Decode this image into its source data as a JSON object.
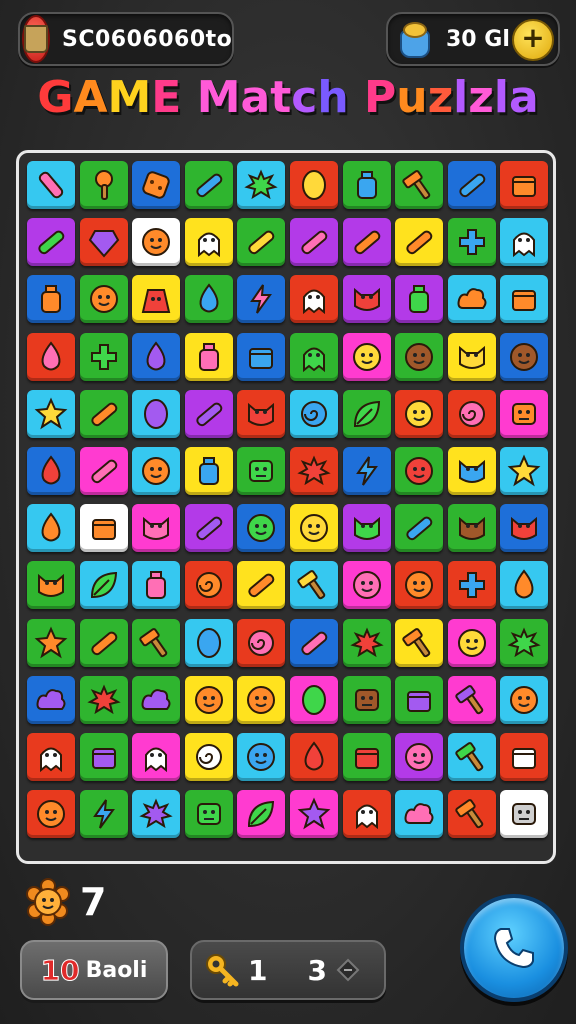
{
  "header": {
    "score_text": "SC0606060to",
    "coin_text": "30 Gl",
    "plus_symbol": "+"
  },
  "title": {
    "letters": [
      {
        "ch": "G",
        "color": "#ff3b3b"
      },
      {
        "ch": "A",
        "color": "#ff8a1e"
      },
      {
        "ch": "M",
        "color": "#ffd21e"
      },
      {
        "ch": "E",
        "color": "#ff3b8a"
      },
      {
        "ch": " ",
        "color": "#ffffff"
      },
      {
        "ch": "M",
        "color": "#ff5ad8"
      },
      {
        "ch": "a",
        "color": "#ff5ad8"
      },
      {
        "ch": "t",
        "color": "#ff5ad8"
      },
      {
        "ch": "c",
        "color": "#b35aff"
      },
      {
        "ch": "h",
        "color": "#7a5aff"
      },
      {
        "ch": " ",
        "color": "#ffffff"
      },
      {
        "ch": "P",
        "color": "#ff3b8a"
      },
      {
        "ch": "u",
        "color": "#ff8a1e"
      },
      {
        "ch": "z",
        "color": "#ff5a3b"
      },
      {
        "ch": "l",
        "color": "#b35aff"
      },
      {
        "ch": "z",
        "color": "#ff5ad8"
      },
      {
        "ch": "l",
        "color": "#b35aff"
      },
      {
        "ch": "a",
        "color": "#b35aff"
      }
    ]
  },
  "board": {
    "tiles": [
      [
        "#36c8f0",
        "pink",
        "lipstick"
      ],
      [
        "#2fb52f",
        "orange",
        "club"
      ],
      [
        "#1e6fd9",
        "orange",
        "cookie"
      ],
      [
        "#2fb52f",
        "blue",
        "bar"
      ],
      [
        "#36c8f0",
        "green",
        "splat"
      ],
      [
        "#e83a1e",
        "yellow",
        "oval"
      ],
      [
        "#2fb52f",
        "blue",
        "bottle"
      ],
      [
        "#2fb52f",
        "orange",
        "hammer"
      ],
      [
        "#1e6fd9",
        "blue",
        "bar"
      ],
      [
        "#e83a1e",
        "orange",
        "box"
      ],
      [
        "#b33ae8",
        "green",
        "bar"
      ],
      [
        "#e83a1e",
        "purple",
        "gem"
      ],
      [
        "#ffffff",
        "orange",
        "face"
      ],
      [
        "#ffe21e",
        "white",
        "ghost"
      ],
      [
        "#2fb52f",
        "yellow",
        "bar"
      ],
      [
        "#b33ae8",
        "pink",
        "bar"
      ],
      [
        "#b33ae8",
        "orange",
        "bar"
      ],
      [
        "#ffe21e",
        "orange",
        "bar"
      ],
      [
        "#2fb52f",
        "blue",
        "cross"
      ],
      [
        "#36c8f0",
        "white",
        "ghost"
      ],
      [
        "#1e6fd9",
        "orange",
        "bottle"
      ],
      [
        "#2fb52f",
        "orange",
        "face"
      ],
      [
        "#ffe21e",
        "red",
        "bag"
      ],
      [
        "#2fb52f",
        "blue",
        "drop"
      ],
      [
        "#1e6fd9",
        "pink",
        "bolt"
      ],
      [
        "#e83a1e",
        "white",
        "ghost"
      ],
      [
        "#b33ae8",
        "red",
        "cat"
      ],
      [
        "#b33ae8",
        "green",
        "bottle"
      ],
      [
        "#36c8f0",
        "orange",
        "cloud"
      ],
      [
        "#36c8f0",
        "orange",
        "box"
      ],
      [
        "#e83a1e",
        "pink",
        "drop"
      ],
      [
        "#2fb52f",
        "green",
        "cross"
      ],
      [
        "#1e6fd9",
        "purple",
        "drop"
      ],
      [
        "#ffe21e",
        "pink",
        "bottle"
      ],
      [
        "#1e6fd9",
        "blue",
        "box"
      ],
      [
        "#2fb52f",
        "green",
        "ghost"
      ],
      [
        "#ff3bd0",
        "yellow",
        "face"
      ],
      [
        "#2fb52f",
        "brown",
        "face"
      ],
      [
        "#ffe21e",
        "yellow",
        "cat"
      ],
      [
        "#1e6fd9",
        "brown",
        "face"
      ],
      [
        "#36c8f0",
        "yellow",
        "star"
      ],
      [
        "#2fb52f",
        "orange",
        "bar"
      ],
      [
        "#36c8f0",
        "purple",
        "oval"
      ],
      [
        "#b33ae8",
        "purple",
        "bar"
      ],
      [
        "#e83a1e",
        "red",
        "cat"
      ],
      [
        "#36c8f0",
        "blue",
        "swirl"
      ],
      [
        "#2fb52f",
        "green",
        "leaf"
      ],
      [
        "#e83a1e",
        "yellow",
        "face"
      ],
      [
        "#e83a1e",
        "pink",
        "swirl"
      ],
      [
        "#ff3bd0",
        "orange",
        "robot"
      ],
      [
        "#1e6fd9",
        "red",
        "drop"
      ],
      [
        "#ff3bd0",
        "pink",
        "bar"
      ],
      [
        "#36c8f0",
        "orange",
        "face"
      ],
      [
        "#ffe21e",
        "blue",
        "bottle"
      ],
      [
        "#2fb52f",
        "green",
        "robot"
      ],
      [
        "#e83a1e",
        "red",
        "splat"
      ],
      [
        "#1e6fd9",
        "blue",
        "bolt"
      ],
      [
        "#2fb52f",
        "red",
        "face"
      ],
      [
        "#ffe21e",
        "blue",
        "cat"
      ],
      [
        "#36c8f0",
        "yellow",
        "star"
      ],
      [
        "#36c8f0",
        "orange",
        "drop"
      ],
      [
        "#ffffff",
        "orange",
        "box"
      ],
      [
        "#ff3bd0",
        "pink",
        "cat"
      ],
      [
        "#b33ae8",
        "purple",
        "bar"
      ],
      [
        "#1e6fd9",
        "green",
        "face"
      ],
      [
        "#ffe21e",
        "yellow",
        "face"
      ],
      [
        "#b33ae8",
        "green",
        "cat"
      ],
      [
        "#2fb52f",
        "blue",
        "bar"
      ],
      [
        "#2fb52f",
        "brown",
        "cat"
      ],
      [
        "#1e6fd9",
        "red",
        "cat"
      ],
      [
        "#2fb52f",
        "orange",
        "cat"
      ],
      [
        "#36c8f0",
        "green",
        "leaf"
      ],
      [
        "#36c8f0",
        "pink",
        "bottle"
      ],
      [
        "#e83a1e",
        "orange",
        "swirl"
      ],
      [
        "#ffe21e",
        "orange",
        "bar"
      ],
      [
        "#36c8f0",
        "yellow",
        "hammer"
      ],
      [
        "#ff3bd0",
        "pink",
        "face"
      ],
      [
        "#e83a1e",
        "orange",
        "face"
      ],
      [
        "#e83a1e",
        "blue",
        "cross"
      ],
      [
        "#36c8f0",
        "orange",
        "drop"
      ],
      [
        "#2fb52f",
        "orange",
        "star"
      ],
      [
        "#2fb52f",
        "orange",
        "bar"
      ],
      [
        "#2fb52f",
        "orange",
        "hammer"
      ],
      [
        "#36c8f0",
        "blue",
        "oval"
      ],
      [
        "#e83a1e",
        "pink",
        "swirl"
      ],
      [
        "#1e6fd9",
        "pink",
        "bar"
      ],
      [
        "#2fb52f",
        "red",
        "splat"
      ],
      [
        "#ffe21e",
        "orange",
        "hammer"
      ],
      [
        "#ff3bd0",
        "yellow",
        "face"
      ],
      [
        "#2fb52f",
        "green",
        "splat"
      ],
      [
        "#1e6fd9",
        "purple",
        "cloud"
      ],
      [
        "#2fb52f",
        "red",
        "splat"
      ],
      [
        "#2fb52f",
        "purple",
        "cloud"
      ],
      [
        "#ffe21e",
        "orange",
        "face"
      ],
      [
        "#ffe21e",
        "orange",
        "face"
      ],
      [
        "#ff3bd0",
        "green",
        "oval"
      ],
      [
        "#2fb52f",
        "brown",
        "robot"
      ],
      [
        "#2fb52f",
        "purple",
        "box"
      ],
      [
        "#ff3bd0",
        "purple",
        "hammer"
      ],
      [
        "#36c8f0",
        "orange",
        "face"
      ],
      [
        "#e83a1e",
        "white",
        "ghost"
      ],
      [
        "#2fb52f",
        "purple",
        "box"
      ],
      [
        "#ff3bd0",
        "white",
        "ghost"
      ],
      [
        "#ffe21e",
        "white",
        "swirl"
      ],
      [
        "#36c8f0",
        "blue",
        "face"
      ],
      [
        "#e83a1e",
        "red",
        "drop"
      ],
      [
        "#2fb52f",
        "red",
        "box"
      ],
      [
        "#b33ae8",
        "pink",
        "face"
      ],
      [
        "#36c8f0",
        "green",
        "hammer"
      ],
      [
        "#e83a1e",
        "white",
        "box"
      ],
      [
        "#e83a1e",
        "orange",
        "face"
      ],
      [
        "#2fb52f",
        "blue",
        "bolt"
      ],
      [
        "#36c8f0",
        "purple",
        "splat"
      ],
      [
        "#2fb52f",
        "green",
        "robot"
      ],
      [
        "#ff3bd0",
        "green",
        "leaf"
      ],
      [
        "#ff3bd0",
        "purple",
        "star"
      ],
      [
        "#e83a1e",
        "white",
        "ghost"
      ],
      [
        "#36c8f0",
        "pink",
        "cloud"
      ],
      [
        "#e83a1e",
        "orange",
        "hammer"
      ],
      [
        "#ffffff",
        "gray",
        "robot"
      ]
    ]
  },
  "moves": {
    "count": "7"
  },
  "ball_button": {
    "number": "10",
    "label": "Baoli"
  },
  "key_counter": {
    "key_count": "1",
    "lock_count": "3"
  },
  "icons": {
    "score": "trophy-cup-icon",
    "coin": "coin-bag-icon",
    "moves": "gear-flower-icon",
    "key": "key-icon",
    "lock": "lock-icon",
    "call": "phone-icon"
  }
}
